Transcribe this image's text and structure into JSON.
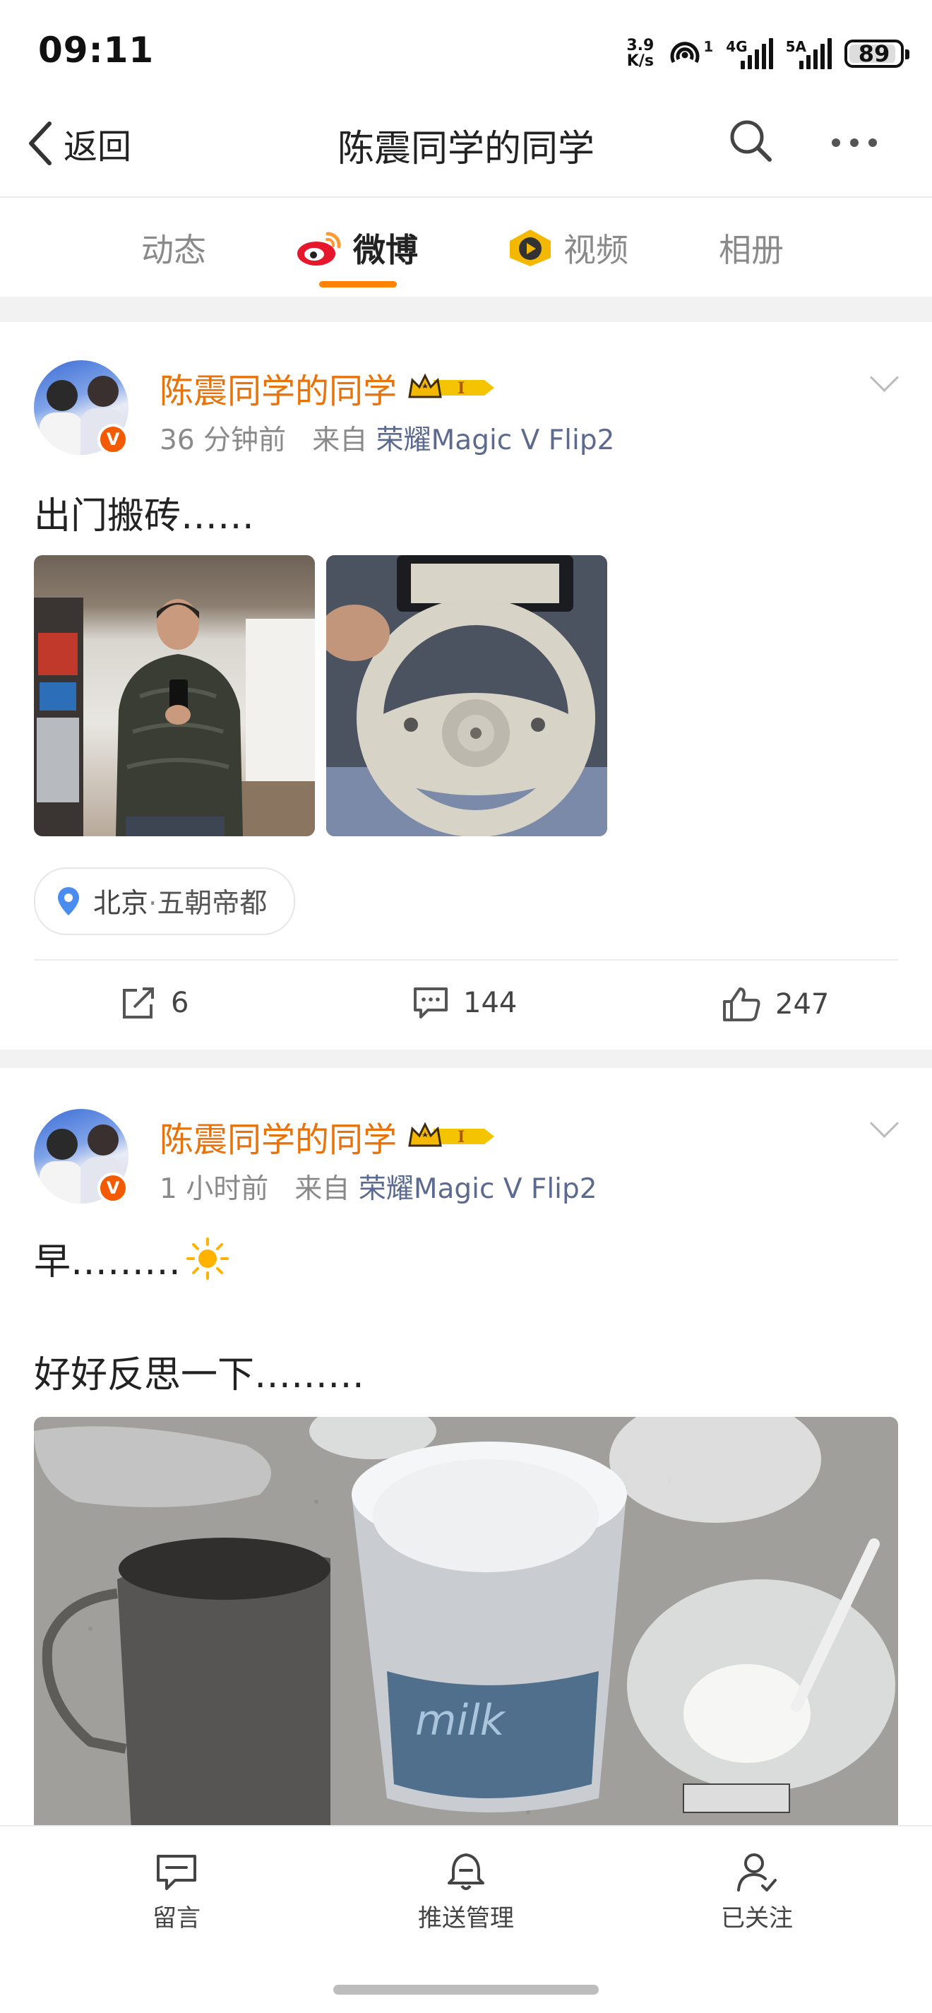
{
  "status_bar": {
    "time": "09:11",
    "speed_value": "3.9",
    "speed_unit": "K/s",
    "hotspot_count": "1",
    "net1": "4G",
    "net2": "5A",
    "battery": "89"
  },
  "nav": {
    "back_label": "返回",
    "title": "陈震同学的同学"
  },
  "tabs": [
    {
      "label": "动态"
    },
    {
      "label": "微博"
    },
    {
      "label": "视频"
    },
    {
      "label": "相册"
    }
  ],
  "posts": [
    {
      "username": "陈震同学的同学",
      "time": "36 分钟前",
      "from_label": "来自",
      "source": "荣耀Magic V Flip2",
      "text": "出门搬砖……",
      "location_city": "北京",
      "location_sep": "·",
      "location_name": "五朝帝都",
      "reposts": "6",
      "comments": "144",
      "likes": "247"
    },
    {
      "username": "陈震同学的同学",
      "time": "1 小时前",
      "from_label": "来自",
      "source": "荣耀Magic V Flip2",
      "text_line1": "早………",
      "text_line2": "好好反思一下………"
    }
  ],
  "bottom_bar": [
    {
      "label": "留言"
    },
    {
      "label": "推送管理"
    },
    {
      "label": "已关注"
    }
  ],
  "colors": {
    "accent_orange": "#ff8200",
    "username": "#e8730c",
    "source_link": "#5d6a8f"
  }
}
